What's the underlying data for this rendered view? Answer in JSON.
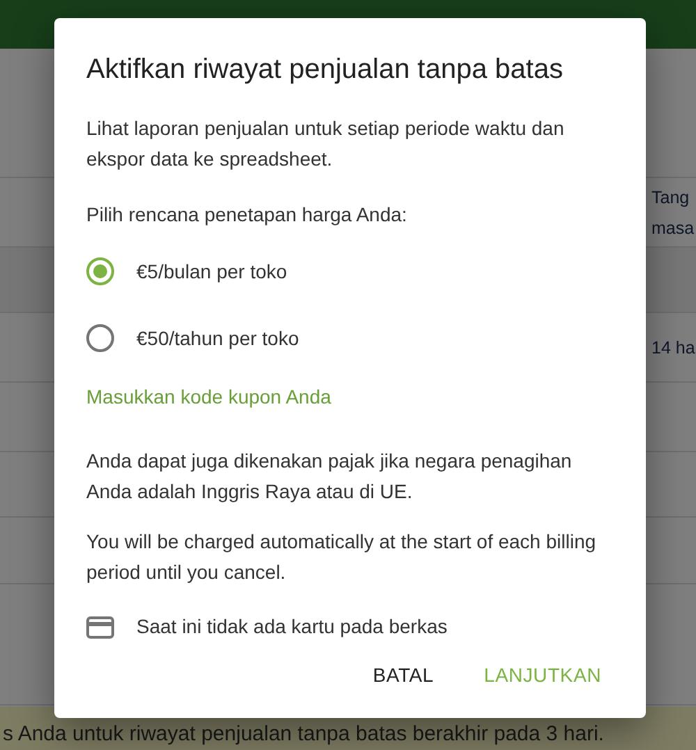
{
  "background": {
    "rows": [
      {
        "lines": [
          "Tang",
          "masa"
        ]
      },
      {
        "lines": [
          "14 ha"
        ]
      }
    ],
    "banner": "s Anda untuk riwayat penjualan tanpa batas berakhir pada 3 hari."
  },
  "dialog": {
    "title": "Aktifkan riwayat penjualan tanpa batas",
    "description": "Lihat laporan penjualan untuk setiap periode waktu dan ekspor data ke spreadsheet.",
    "plan_prompt": "Pilih rencana penetapan harga Anda:",
    "plans": [
      {
        "label": "€5/bulan per toko",
        "selected": true
      },
      {
        "label": "€50/tahun per toko",
        "selected": false
      }
    ],
    "coupon_link": "Masukkan kode kupon Anda",
    "tax_note": "Anda dapat juga dikenakan pajak jika negara penagihan Anda adalah Inggris Raya atau di UE.",
    "charge_note": "You will be charged automatically at the start of each billing period until you cancel.",
    "card_status": "Saat ini tidak ada kartu pada berkas",
    "buttons": [
      {
        "label": "BATAL",
        "kind": "cancel"
      },
      {
        "label": "LANJUTKAN",
        "kind": "primary"
      }
    ]
  }
}
